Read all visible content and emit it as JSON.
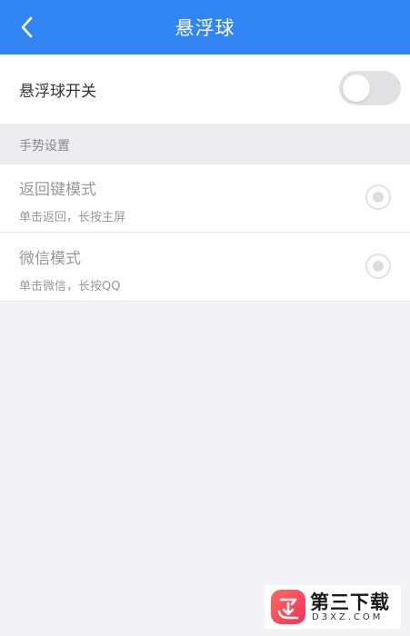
{
  "header": {
    "title": "悬浮球",
    "back_icon": "chevron-left-icon",
    "color": "#3285f4"
  },
  "floating_ball": {
    "toggle_label": "悬浮球开关",
    "enabled": false
  },
  "gestures": {
    "section_title": "手势设置",
    "options": [
      {
        "title": "返回键模式",
        "subtitle": "单击返回，长按主屏"
      },
      {
        "title": "微信模式",
        "subtitle": "单击微信，长按QQ"
      }
    ]
  },
  "watermark": {
    "name": "第三下载",
    "domain": "D3XZ.COM",
    "logo": "download-logo-icon"
  }
}
